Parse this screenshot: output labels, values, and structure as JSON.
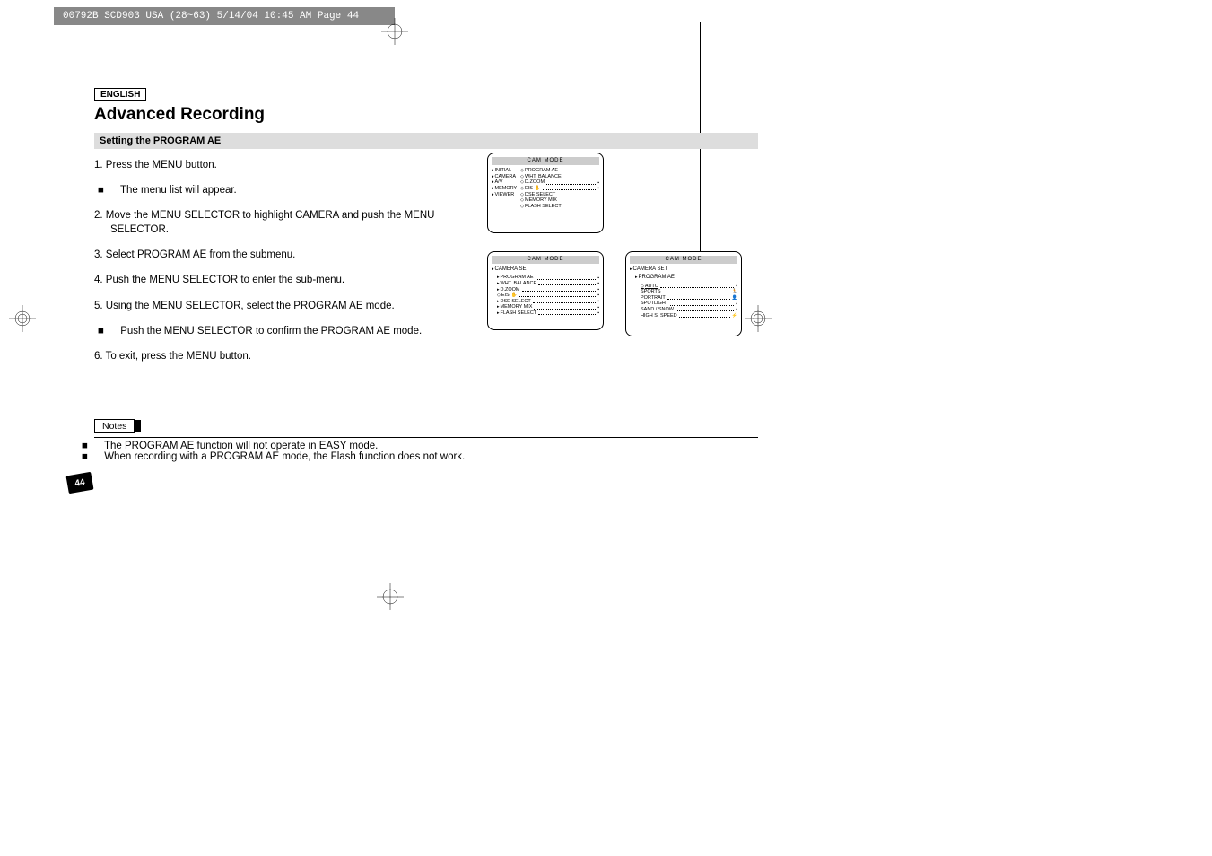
{
  "header_strip": "00792B SCD903 USA (28~63)  5/14/04 10:45 AM  Page 44",
  "lang_badge": "ENGLISH",
  "section_title": "Advanced Recording",
  "subsection_title": "Setting the PROGRAM AE",
  "steps": {
    "s1": "1.  Press the MENU button.",
    "s1a": "The menu list will appear.",
    "s2": "2.  Move the MENU SELECTOR to highlight CAMERA and push the MENU SELECTOR.",
    "s3": "3.  Select PROGRAM AE from the submenu.",
    "s4": "4.  Push the MENU SELECTOR to enter the sub-menu.",
    "s5": "5.  Using the MENU SELECTOR, select the PROGRAM AE mode.",
    "s5a": "Push the MENU SELECTOR to confirm the PROGRAM AE mode.",
    "s6": "6.  To exit, press the MENU button."
  },
  "notes_label": "Notes",
  "notes": {
    "n1": "The PROGRAM AE function will not operate in EASY mode.",
    "n2": "When recording with a PROGRAM AE mode, the Flash function does not work."
  },
  "page_number": "44",
  "screen1": {
    "title": "CAM  MODE",
    "left_items": [
      "INITIAL",
      "CAMERA",
      "A/V",
      "MEMORY",
      "VIEWER"
    ],
    "right_items": [
      "PROGRAM AE",
      "WHT. BALANCE",
      "D.ZOOM",
      "EIS",
      "DSE SELECT",
      "MEMORY MIX",
      "FLASH SELECT"
    ]
  },
  "screen2": {
    "title": "CAM  MODE",
    "subhead": "CAMERA SET",
    "items": [
      "PROGRAM AE",
      "WHT. BALANCE",
      "D.ZOOM",
      "EIS",
      "DSE SELECT",
      "MEMORY MIX",
      "FLASH SELECT"
    ]
  },
  "screen3": {
    "title": "CAM  MODE",
    "subhead": "CAMERA SET",
    "subhead2": "PROGRAM AE",
    "items": [
      "AUTO",
      "SPORTS",
      "PORTRAIT",
      "SPOTLIGHT",
      "SAND / SNOW",
      "HIGH S. SPEED"
    ]
  }
}
